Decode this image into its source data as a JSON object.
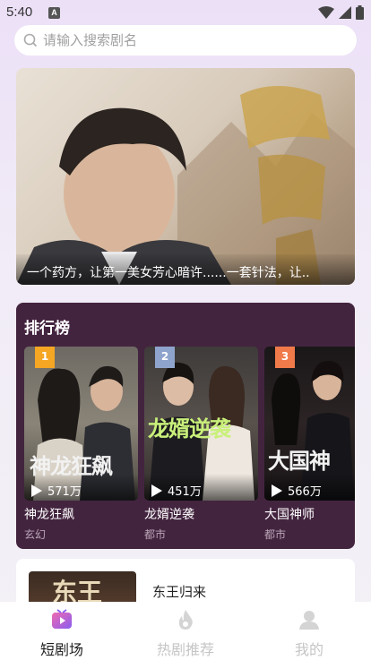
{
  "status_bar": {
    "time": "5:40",
    "badge": "A"
  },
  "search": {
    "placeholder": "请输入搜索剧名"
  },
  "banner": {
    "caption": "一个药方，让第一美女芳心暗许......一套针法，让.."
  },
  "ranking": {
    "title": "排行榜",
    "items": [
      {
        "rank": "1",
        "name": "神龙狂飙",
        "tag": "玄幻",
        "views": "571万",
        "badge_color": "#f5a623",
        "cover_text": "神龙狂飙"
      },
      {
        "rank": "2",
        "name": "龙婿逆袭",
        "tag": "都市",
        "views": "451万",
        "badge_color": "#8fa4cc",
        "cover_text": "龙婿逆袭"
      },
      {
        "rank": "3",
        "name": "大国神师",
        "tag": "都市",
        "views": "566万",
        "badge_color": "#f07a4a",
        "cover_text": "大国神"
      }
    ]
  },
  "next_card": {
    "title": "东王归来",
    "thumb_text": "东王"
  },
  "tabbar": {
    "tabs": [
      {
        "label": "短剧场",
        "icon": "tv-play-icon",
        "active": true
      },
      {
        "label": "热剧推荐",
        "icon": "flame-icon",
        "active": false
      },
      {
        "label": "我的",
        "icon": "profile-icon",
        "active": false
      }
    ]
  }
}
